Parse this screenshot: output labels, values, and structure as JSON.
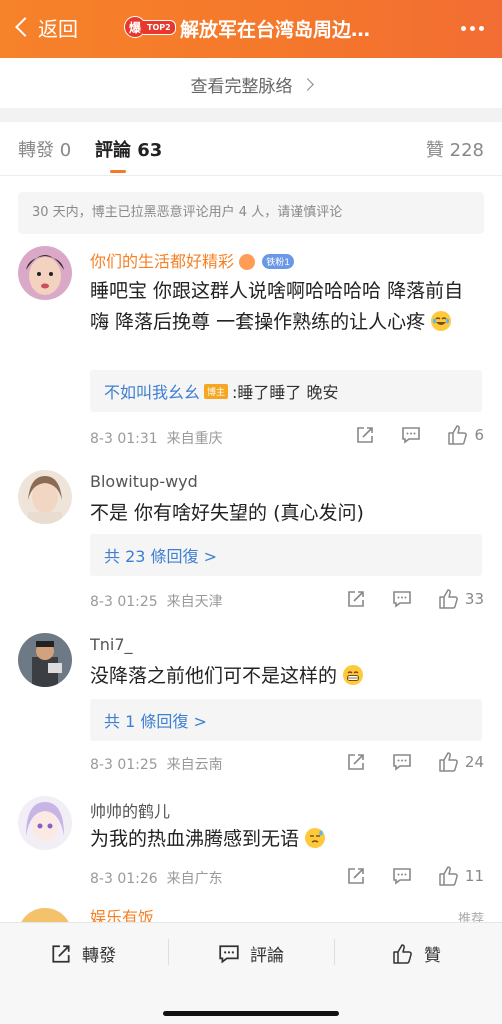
{
  "header": {
    "back_label": "返回",
    "badge_fire": "爆",
    "badge_rank": "TOP2",
    "title": "解放军在台湾岛周边…",
    "more_icon": "more-icon"
  },
  "context": {
    "label": "查看完整脉络"
  },
  "tabs": [
    {
      "label": "轉發 0"
    },
    {
      "label": "評論 63"
    },
    {
      "label": "贊 228"
    }
  ],
  "notice": "30 天内，博主已拉黑恶意评论用户 4 人，请谨慎评论",
  "comments": [
    {
      "name": "你们的生活都好精彩",
      "fan_badge": "铁粉1",
      "text": "睡吧宝 你跟这群人说啥啊哈哈哈哈 降落前自嗨 降落后挽尊 一套操作熟练的让人心疼",
      "reply_name": "不如叫我幺幺",
      "reply_badge": "博主",
      "reply_text": ":睡了睡了 晚安",
      "time": "8-3 01:31",
      "location": "来自重庆",
      "likes": "6"
    },
    {
      "name": "Blowitup-wyd",
      "text": "不是 你有啥好失望的 (真心发问)",
      "replies_label": "共 23 條回復 >",
      "time": "8-3 01:25",
      "location": "来自天津",
      "likes": "33"
    },
    {
      "name": "Tni7_",
      "text": "没降落之前他们可不是这样的",
      "replies_label": "共 1 條回復 >",
      "time": "8-3 01:25",
      "location": "来自云南",
      "likes": "24"
    },
    {
      "name": "帅帅的鹤儿",
      "text": "为我的热血沸腾感到无语",
      "time": "8-3 01:26",
      "location": "来自广东",
      "likes": "11"
    },
    {
      "name": "娱乐有饭",
      "hint": "推荐"
    }
  ],
  "bottom_bar": {
    "repost": "轉發",
    "comment": "評論",
    "like": "贊"
  },
  "colors": {
    "header_orange": "#f5782b",
    "name_orange": "#f58126",
    "link_blue": "#3d7fd1"
  }
}
